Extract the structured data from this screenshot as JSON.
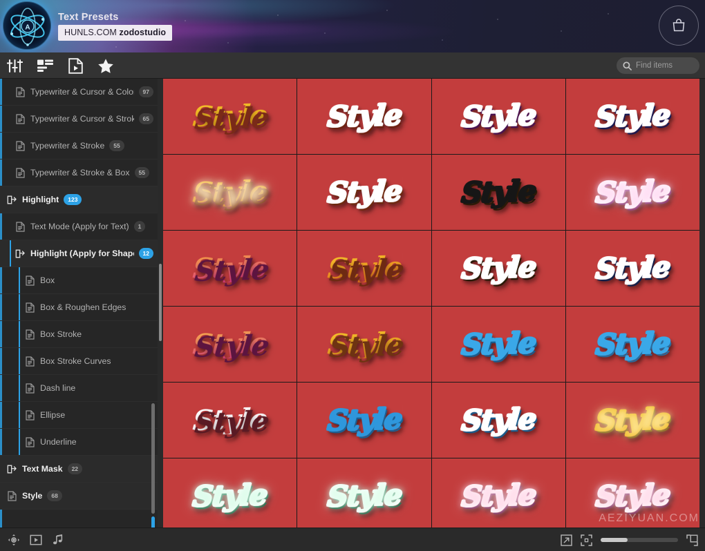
{
  "banner": {
    "title": "Text Presets",
    "chip_prefix": "HUNLS.COM ",
    "chip_brand": "zodostudio",
    "logo_letter": "A",
    "bag_icon": "shopping-bag-icon"
  },
  "toolbar": {
    "icons": [
      {
        "name": "sliders-icon",
        "label": "Adjust"
      },
      {
        "name": "layout-list-icon",
        "label": "Layout"
      },
      {
        "name": "file-play-icon",
        "label": "Preview"
      },
      {
        "name": "star-icon",
        "label": "Favorites"
      }
    ],
    "search": {
      "placeholder": "Find items",
      "value": "",
      "icon": "search-icon"
    }
  },
  "sidebar": {
    "items": [
      {
        "label": "Typewriter & Cursor & Color",
        "badge": "97",
        "badge_style": "gray",
        "icon": "file-icon",
        "level": 1,
        "state": "normal"
      },
      {
        "label": "Typewriter & Cursor & Stroke",
        "badge": "65",
        "badge_style": "gray",
        "icon": "file-icon",
        "level": 1,
        "state": "normal"
      },
      {
        "label": "Typewriter & Stroke",
        "badge": "55",
        "badge_style": "gray",
        "icon": "file-icon",
        "level": 1,
        "state": "normal"
      },
      {
        "label": "Typewriter & Stroke & Box",
        "badge": "55",
        "badge_style": "gray",
        "icon": "file-icon",
        "level": 1,
        "state": "normal"
      },
      {
        "label": "Highlight",
        "badge": "123",
        "badge_style": "blue",
        "icon": "folder-icon",
        "level": 0,
        "state": "group"
      },
      {
        "label": "Text Mode (Apply for Text)",
        "badge": "1",
        "badge_style": "gray",
        "icon": "file-icon",
        "level": 1,
        "state": "normal"
      },
      {
        "label": "Highlight (Apply for Shape)",
        "badge": "12",
        "badge_style": "blue",
        "icon": "folder-icon",
        "level": 1,
        "state": "selected"
      },
      {
        "label": "Box",
        "badge": "",
        "badge_style": "none",
        "icon": "file-icon",
        "level": 2,
        "state": "child"
      },
      {
        "label": "Box & Roughen Edges",
        "badge": "",
        "badge_style": "none",
        "icon": "file-icon",
        "level": 2,
        "state": "child"
      },
      {
        "label": "Box Stroke",
        "badge": "",
        "badge_style": "none",
        "icon": "file-icon",
        "level": 2,
        "state": "child"
      },
      {
        "label": "Box Stroke Curves",
        "badge": "",
        "badge_style": "none",
        "icon": "file-icon",
        "level": 2,
        "state": "child"
      },
      {
        "label": "Dash line",
        "badge": "",
        "badge_style": "none",
        "icon": "file-icon",
        "level": 2,
        "state": "child"
      },
      {
        "label": "Ellipse",
        "badge": "",
        "badge_style": "none",
        "icon": "file-icon",
        "level": 2,
        "state": "child"
      },
      {
        "label": "Underline",
        "badge": "",
        "badge_style": "none",
        "icon": "file-icon",
        "level": 2,
        "state": "child"
      },
      {
        "label": "Text Mask",
        "badge": "22",
        "badge_style": "gray",
        "icon": "folder-icon",
        "level": 0,
        "state": "group"
      },
      {
        "label": "Style",
        "badge": "68",
        "badge_style": "gray",
        "icon": "file-icon",
        "level": 0,
        "state": "group"
      }
    ]
  },
  "bottombar": {
    "left_icons": [
      {
        "name": "transform-move-icon"
      },
      {
        "name": "play-box-icon"
      },
      {
        "name": "music-note-icon"
      }
    ],
    "right_icons": [
      {
        "name": "expand-arrow-icon"
      },
      {
        "name": "fit-frame-icon"
      },
      {
        "name": "fullscreen-icon"
      }
    ],
    "zoom_slider": {
      "name": "zoom-slider",
      "value": 35
    }
  },
  "grid": {
    "tile_background": "#c33d3d",
    "watermark": "AEZIYUAN.COM",
    "tiles": [
      {
        "text": "Style",
        "c1": "#f6c22a",
        "c2": "#e8a515",
        "outline": "none",
        "glow": "none",
        "shadow": "#7a2a18"
      },
      {
        "text": "Style",
        "c1": "#f6a820",
        "c2": "#e07a14",
        "outline": "#ffffff",
        "glow": "none",
        "shadow": "#6e2212"
      },
      {
        "text": "Style",
        "c1": "#d81a72",
        "c2": "#7a2ec0",
        "outline": "#ffffff",
        "glow": "none",
        "shadow": "#4a1350"
      },
      {
        "text": "Style",
        "c1": "#4db4ee",
        "c2": "#3b35b8",
        "outline": "#ffffff",
        "glow": "none",
        "shadow": "#1a1a52"
      },
      {
        "text": "Style",
        "c1": "#f6b82a",
        "c2": "#e07a14",
        "outline": "none",
        "glow": "#ffe9c0",
        "shadow": "#7a3314"
      },
      {
        "text": "Style",
        "c1": "#f7a81c",
        "c2": "#e07c12",
        "outline": "#ffffff",
        "glow": "none",
        "shadow": "#6e2a10"
      },
      {
        "text": "Style",
        "c1": "#f0a018",
        "c2": "#d98a10",
        "outline": "#161616",
        "glow": "none",
        "shadow": "#2a1a08"
      },
      {
        "text": "Style",
        "c1": "#ff9de0",
        "c2": "#e84bc0",
        "outline": "#ffffff",
        "glow": "#ffd9f2",
        "shadow": "#7a1f62"
      },
      {
        "text": "Style",
        "c1": "#f59a4a",
        "c2": "#e03a86",
        "outline": "none",
        "glow": "none",
        "shadow": "#5c1440"
      },
      {
        "text": "Style",
        "c1": "#f6c22a",
        "c2": "#e8731a",
        "outline": "none",
        "glow": "none",
        "shadow": "#6e2a12"
      },
      {
        "text": "Style",
        "c1": "#e84a14",
        "c2": "#e8b41c",
        "outline": "#ffffff",
        "glow": "none",
        "shadow": "#2a1a08"
      },
      {
        "text": "Style",
        "c1": "#2f3fa8",
        "c2": "#3fd6e0",
        "outline": "#ffffff",
        "glow": "none",
        "shadow": "#12204a"
      },
      {
        "text": "Style",
        "c1": "#f7a850",
        "c2": "#e0407e",
        "outline": "none",
        "glow": "none",
        "shadow": "#5c1440"
      },
      {
        "text": "Style",
        "c1": "#f6c22a",
        "c2": "#e08a1c",
        "outline": "none",
        "glow": "none",
        "shadow": "#6e3312"
      },
      {
        "text": "Style",
        "c1": "#ffffff",
        "c2": "#e8f4fa",
        "outline": "#3aa8e8",
        "glow": "none",
        "shadow": "#1a5a8a"
      },
      {
        "text": "Style",
        "c1": "#ffffff",
        "c2": "#eef6fc",
        "outline": "#3aa8e8",
        "glow": "none",
        "shadow": "#2a6a9a"
      },
      {
        "text": "Style",
        "c1": "#ffffff",
        "c2": "#f6eef2",
        "outline": "none",
        "glow": "none",
        "shadow": "#5a1a24"
      },
      {
        "text": "Style",
        "c1": "#ffffff",
        "c2": "#f0f8fd",
        "outline": "#2f97dc",
        "glow": "none",
        "shadow": "#1d5f90"
      },
      {
        "text": "Style",
        "c1": "#9fd8f5",
        "c2": "#4ab4ea",
        "outline": "#ffffff",
        "glow": "none",
        "shadow": "#1a5a8a"
      },
      {
        "text": "Style",
        "c1": "#fff4d0",
        "c2": "#f5c42a",
        "outline": "#f0b81e",
        "glow": "#ffe9a0",
        "shadow": "#7a5a10"
      },
      {
        "text": "Style",
        "c1": "#7fe8b4",
        "c2": "#16a86a",
        "outline": "#ffffff",
        "glow": "#d8fce8",
        "shadow": "#0d5a38"
      },
      {
        "text": "Style",
        "c1": "#8cecb8",
        "c2": "#18ab6c",
        "outline": "#ffffff",
        "glow": "#dcfdea",
        "shadow": "#0d5a38"
      },
      {
        "text": "Style",
        "c1": "#f7a450",
        "c2": "#e0408c",
        "outline": "#ffffff",
        "glow": "#ffd8e8",
        "shadow": "#6a1848"
      },
      {
        "text": "Style",
        "c1": "#f49a46",
        "c2": "#e03a90",
        "outline": "#ffffff",
        "glow": "#ffd8e8",
        "shadow": "#6a1848"
      }
    ]
  }
}
